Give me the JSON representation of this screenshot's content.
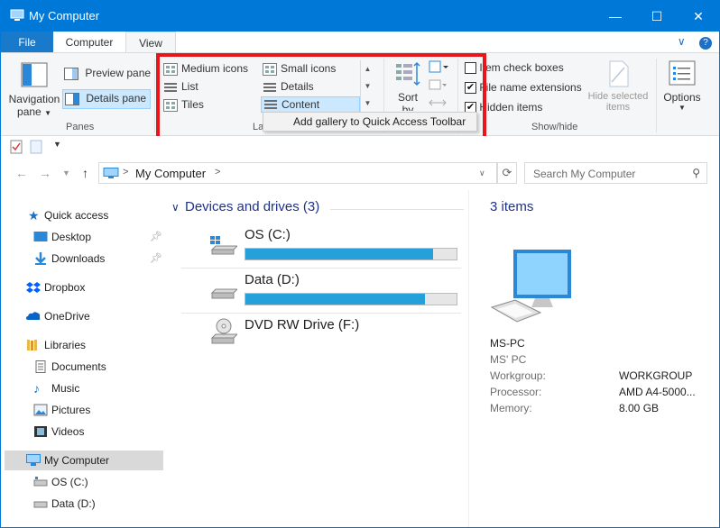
{
  "window": {
    "title": "My Computer",
    "min_glyph": "—",
    "max_glyph": "☐",
    "close_glyph": "✕"
  },
  "tabs": {
    "file": "File",
    "computer": "Computer",
    "view": "View",
    "collapse_glyph": "∨",
    "help_glyph": "?"
  },
  "ribbon": {
    "panes": {
      "navigation_line1": "Navigation",
      "navigation_line2": "pane",
      "preview": "Preview pane",
      "details": "Details pane",
      "group_label": "Panes"
    },
    "layout": {
      "medium_icons": "Medium icons",
      "small_icons": "Small icons",
      "list": "List",
      "details": "Details",
      "tiles": "Tiles",
      "content": "Content",
      "group_label_fragment": "La"
    },
    "current_view": {
      "sort_line1": "Sort",
      "sort_line2": "by"
    },
    "show_hide": {
      "item_check_boxes": "Item check boxes",
      "item_check_boxes_checked": false,
      "file_name_extensions": "File name extensions",
      "file_name_extensions_checked": true,
      "hidden_items": "Hidden items",
      "hidden_items_checked": true,
      "hide_selected_line1": "Hide selected",
      "hide_selected_line2": "items",
      "group_label": "Show/hide"
    },
    "options": {
      "label": "Options"
    }
  },
  "context_menu": {
    "add_gallery": "Add gallery to Quick Access Toolbar"
  },
  "address": {
    "path": "My Computer",
    "separator": ">",
    "search_placeholder": "Search My Computer"
  },
  "nav": {
    "quick_access": "Quick access",
    "desktop": "Desktop",
    "downloads": "Downloads",
    "dropbox": "Dropbox",
    "onedrive": "OneDrive",
    "libraries": "Libraries",
    "documents": "Documents",
    "music": "Music",
    "pictures": "Pictures",
    "videos": "Videos",
    "my_computer": "My Computer",
    "os_c": "OS (C:)",
    "data_d": "Data (D:)"
  },
  "content": {
    "group_header": "Devices and drives (3)",
    "drives": [
      {
        "name": "OS (C:)",
        "usage_fraction": 0.89
      },
      {
        "name": "Data (D:)",
        "usage_fraction": 0.85
      },
      {
        "name": "DVD RW Drive (F:)"
      }
    ]
  },
  "details": {
    "count": "3 items",
    "name": "MS-PC",
    "subtitle": "MS' PC",
    "workgroup_label": "Workgroup:",
    "workgroup_value": "WORKGROUP",
    "processor_label": "Processor:",
    "processor_value": "AMD A4-5000...",
    "memory_label": "Memory:",
    "memory_value": "8.00 GB"
  },
  "colors": {
    "accent": "#0078d7",
    "drive_bar": "#26a0da",
    "highlight_box": "#e8151d"
  }
}
